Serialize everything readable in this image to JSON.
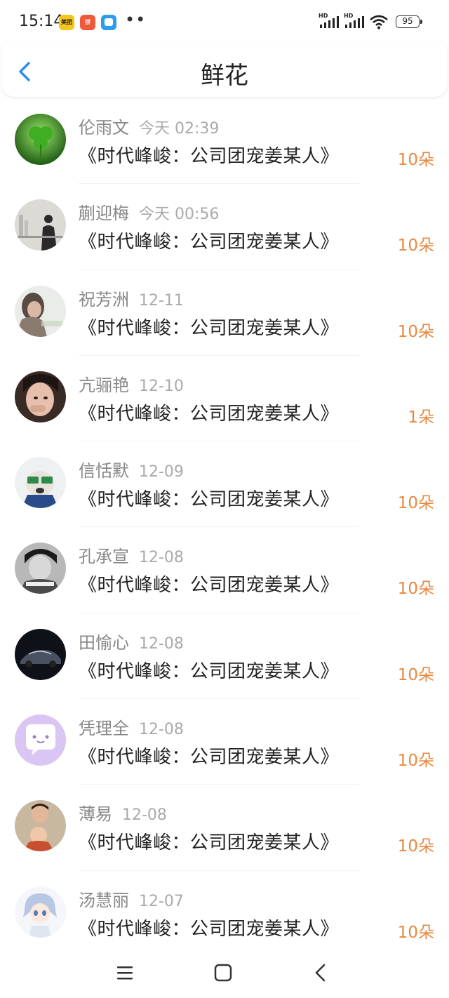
{
  "status_bar": {
    "time": "15:14",
    "battery": "95",
    "apps": [
      {
        "name": "meituan-icon",
        "label": "美团",
        "color": "#f5c518"
      },
      {
        "name": "shop-icon",
        "label": "拼",
        "color": "#ef5a3a"
      },
      {
        "name": "chat-app-icon",
        "label": "",
        "color": "#2d9cf0"
      }
    ],
    "dots": "••",
    "signal_labels": [
      "HD",
      "HD"
    ]
  },
  "header": {
    "title": "鲜花"
  },
  "rows": [
    {
      "name": "伦雨文",
      "time": "今天 02:39",
      "book": "《时代峰峻：公司团宠姜某人》",
      "count": "10朵"
    },
    {
      "name": "蒯迎梅",
      "time": "今天 00:56",
      "book": "《时代峰峻：公司团宠姜某人》",
      "count": "10朵"
    },
    {
      "name": "祝芳洲",
      "time": "12-11",
      "book": "《时代峰峻：公司团宠姜某人》",
      "count": "10朵"
    },
    {
      "name": "亢骊艳",
      "time": "12-10",
      "book": "《时代峰峻：公司团宠姜某人》",
      "count": "1朵"
    },
    {
      "name": "信恬默",
      "time": "12-09",
      "book": "《时代峰峻：公司团宠姜某人》",
      "count": "10朵"
    },
    {
      "name": "孔承宣",
      "time": "12-08",
      "book": "《时代峰峻：公司团宠姜某人》",
      "count": "10朵"
    },
    {
      "name": "田愉心",
      "time": "12-08",
      "book": "《时代峰峻：公司团宠姜某人》",
      "count": "10朵"
    },
    {
      "name": "凭理全",
      "time": "12-08",
      "book": "《时代峰峻：公司团宠姜某人》",
      "count": "10朵"
    },
    {
      "name": "薄易",
      "time": "12-08",
      "book": "《时代峰峻：公司团宠姜某人》",
      "count": "10朵"
    },
    {
      "name": "汤慧丽",
      "time": "12-07",
      "book": "《时代峰峻：公司团宠姜某人》",
      "count": "10朵"
    }
  ],
  "colors": {
    "accent": "#2d8cf0",
    "count": "#e9883e"
  }
}
